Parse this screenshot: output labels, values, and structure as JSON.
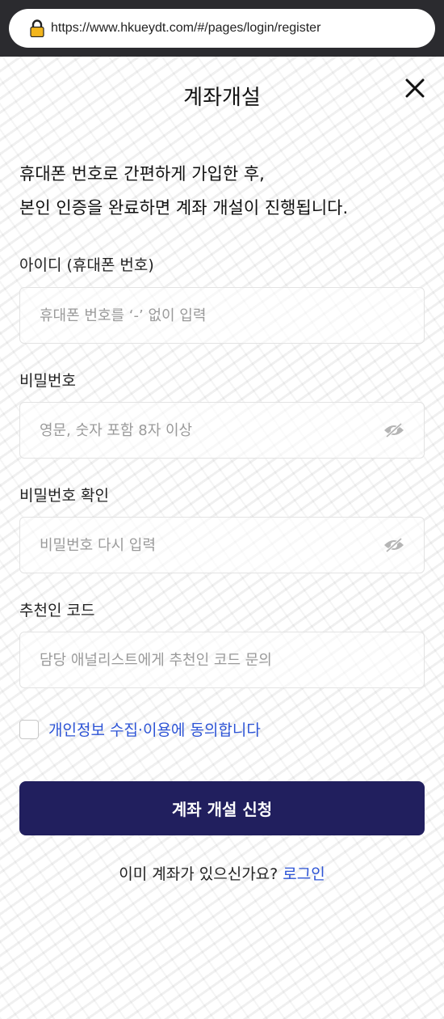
{
  "browser": {
    "url": "https://www.hkueydt.com/#/pages/login/register"
  },
  "header": {
    "title": "계좌개설"
  },
  "intro": {
    "line1": "휴대폰 번호로 간편하게 가입한 후,",
    "line2": "본인 인증을 완료하면 계좌 개설이 진행됩니다."
  },
  "form": {
    "phone": {
      "label": "아이디 (휴대폰 번호)",
      "placeholder": "휴대폰 번호를 ‘-’ 없이 입력",
      "value": ""
    },
    "password": {
      "label": "비밀번호",
      "placeholder": "영문, 숫자 포함 8자 이상",
      "value": ""
    },
    "password_confirm": {
      "label": "비밀번호 확인",
      "placeholder": "비밀번호 다시 입력",
      "value": ""
    },
    "referral": {
      "label": "추천인 코드",
      "placeholder": "담당 애널리스트에게 추천인 코드 문의",
      "value": ""
    }
  },
  "consent": {
    "label": "개인정보 수집·이용에 동의합니다"
  },
  "submit": {
    "label": "계좌 개설 신청"
  },
  "footer": {
    "prompt": "이미 계좌가 있으신가요?",
    "login_link": "로그인"
  },
  "icons": {
    "lock": "lock-icon",
    "close": "close-icon",
    "eye": "eye-slash-icon"
  },
  "colors": {
    "primary": "#211f5e",
    "link": "#2d54d6",
    "browser_bar": "#2b2b2f"
  }
}
